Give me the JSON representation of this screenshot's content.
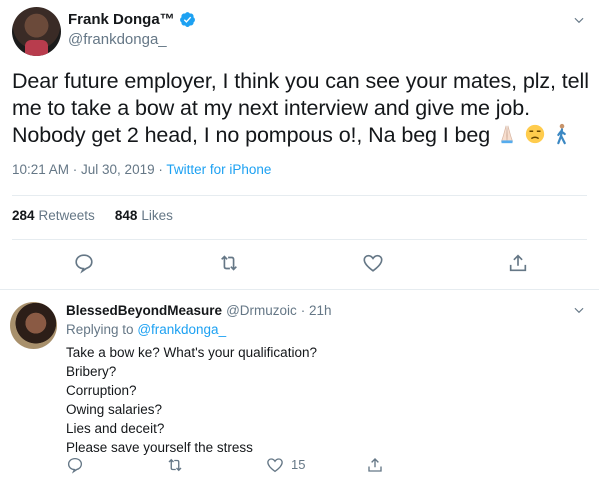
{
  "tweet": {
    "author_name": "Frank Donga™",
    "author_handle": "@frankdonga_",
    "text": "Dear future employer, I think you can see your mates, plz, tell me to take a bow at my next interview and give me job. Nobody get 2 head, I no pompous o!, Na beg I beg",
    "emojis": [
      "folded-hands-emoji",
      "unamused-face-emoji",
      "walking-man-emoji"
    ],
    "timestamp": "10:21 AM · Jul 30, 2019",
    "meta_sep": " · ",
    "source": "Twitter for iPhone",
    "retweets_count": "284",
    "retweets_label": "Retweets",
    "likes_count": "848",
    "likes_label": "Likes"
  },
  "reply": {
    "author_name": "BlessedBeyondMeasure",
    "author_handle": "@Drmuzoic",
    "time": "· 21h",
    "replying_prefix": "Replying to",
    "replying_to": "@frankdonga_",
    "lines": [
      "Take a bow ke? What's your qualification?",
      "Bribery?",
      "Corruption?",
      "Owing salaries?",
      "Lies and deceit?",
      "Please save yourself the stress"
    ],
    "likes_count": "15"
  },
  "colors": {
    "accent": "#1da1f2",
    "secondary_text": "#657786",
    "primary_text": "#14171a",
    "divider": "#e6ecf0"
  }
}
